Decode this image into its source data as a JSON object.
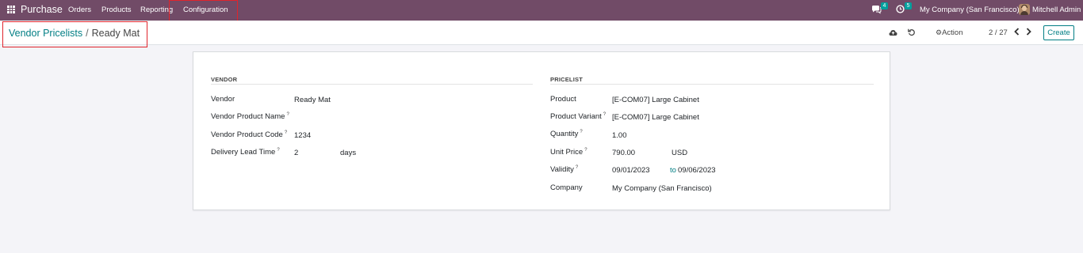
{
  "navbar": {
    "app_name": "Purchase",
    "menu": [
      "Orders",
      "Products",
      "Reporting",
      "Configuration"
    ],
    "messages_count": "4",
    "activities_count": "5",
    "company": "My Company (San Francisco)",
    "user": "Mitchell Admin",
    "bg_color": "#714b67"
  },
  "breadcrumb": {
    "parent": "Vendor Pricelists",
    "separator": "/",
    "current": "Ready Mat"
  },
  "toolbar": {
    "action_label": "Action",
    "pager": "2 / 27",
    "create_label": "Create"
  },
  "form": {
    "vendor_section": {
      "title": "VENDOR",
      "vendor_label": "Vendor",
      "vendor_value": "Ready Mat",
      "product_name_label": "Vendor Product Name",
      "product_name_value": "",
      "product_code_label": "Vendor Product Code",
      "product_code_value": "1234",
      "lead_time_label": "Delivery Lead Time",
      "lead_time_value": "2",
      "lead_time_unit": "days"
    },
    "pricelist_section": {
      "title": "PRICELIST",
      "product_label": "Product",
      "product_value": "[E-COM07] Large Cabinet",
      "variant_label": "Product Variant",
      "variant_value": "[E-COM07] Large Cabinet",
      "quantity_label": "Quantity",
      "quantity_value": "1.00",
      "price_label": "Unit Price",
      "price_value": "790.00",
      "currency": "USD",
      "validity_label": "Validity",
      "validity_from": "09/01/2023",
      "validity_to_label": "to",
      "validity_to": "09/06/2023",
      "company_label": "Company",
      "company_value": "My Company (San Francisco)"
    },
    "help_marker": "?"
  },
  "icons": {
    "apps": "apps-grid-icon",
    "messages": "chat-icon",
    "activities": "clock-icon",
    "save": "cloud-upload-icon",
    "discard": "undo-icon",
    "action": "gear-icon",
    "prev": "chevron-left-icon",
    "next": "chevron-right-icon"
  }
}
